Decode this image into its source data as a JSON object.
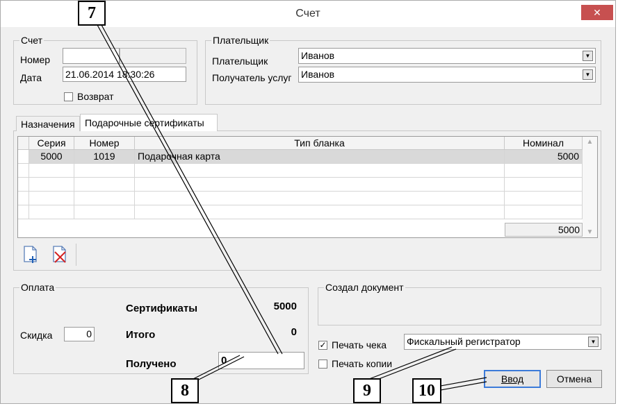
{
  "window": {
    "title": "Счет",
    "close_label": "✕"
  },
  "invoice_group": {
    "title": "Счет",
    "number_label": "Номер",
    "number_value": "",
    "date_label": "Дата",
    "date_value": "21.06.2014 18:30:26",
    "return_label": "Возврат",
    "return_checked": false
  },
  "payer_group": {
    "title": "Плательщик",
    "payer_label": "Плательщик",
    "payer_value": "Иванов",
    "recipient_label": "Получатель услуг",
    "recipient_value": "Иванов"
  },
  "tabs": [
    {
      "label": "Назначения"
    },
    {
      "label": "Подарочные сертификаты"
    }
  ],
  "grid": {
    "columns": [
      "Серия",
      "Номер",
      "Тип бланка",
      "Номинал"
    ],
    "rows": [
      {
        "series": "5000",
        "number": "1019",
        "blank_type": "Подарочная карта",
        "nominal": "5000"
      }
    ],
    "total": "5000"
  },
  "payment_group": {
    "title": "Оплата",
    "discount_label": "Скидка",
    "discount_value": "0",
    "certificates_label": "Сертификаты",
    "certificates_value": "5000",
    "total_label": "Итого",
    "total_value": "0",
    "received_label": "Получено",
    "received_value": "0"
  },
  "creator_group": {
    "title": "Создал документ"
  },
  "print": {
    "receipt_label": "Печать чека",
    "receipt_checked": true,
    "copy_label": "Печать копии",
    "copy_checked": false,
    "device_value": "Фискальный регистратор"
  },
  "buttons": {
    "ok": "Ввод",
    "cancel": "Отмена"
  },
  "callouts": [
    "7",
    "8",
    "9",
    "10"
  ]
}
